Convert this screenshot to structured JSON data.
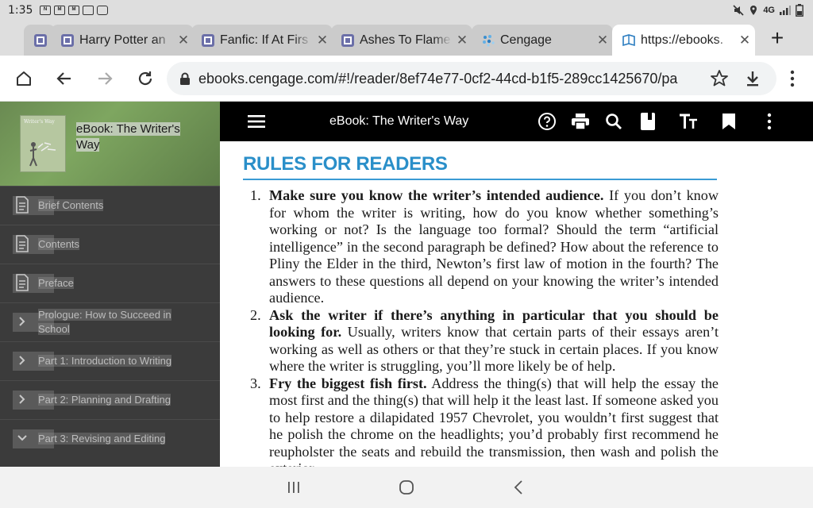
{
  "status": {
    "time": "1:35",
    "notifications": [
      "news-icon",
      "mail-icon",
      "mail-icon",
      "calendar-icon",
      "message-icon"
    ],
    "right_text": "4G"
  },
  "tabs": [
    {
      "title": "",
      "favicon": "reader-icon"
    },
    {
      "title": "Harry Potter an",
      "favicon": "reader-icon"
    },
    {
      "title": "Fanfic: If At Firs",
      "favicon": "reader-icon"
    },
    {
      "title": "Ashes To Flame",
      "favicon": "reader-icon"
    },
    {
      "title": "Cengage",
      "favicon": "cengage-icon"
    },
    {
      "title": "https://ebooks.",
      "favicon": "book-icon"
    }
  ],
  "newtab_label": "+",
  "toolbar": {
    "url": "ebooks.cengage.com/#!/reader/8ef74e77-0cf2-44cd-b1f5-289cc1425670/pa"
  },
  "sidebar": {
    "book_title": "eBook: The Writer's Way",
    "cover_title": "Writer's Way",
    "items": [
      {
        "label": "Brief Contents",
        "icon": "document-icon"
      },
      {
        "label": "Contents",
        "icon": "document-icon"
      },
      {
        "label": "Preface",
        "icon": "document-icon"
      },
      {
        "label": "Prologue: How to Succeed in School",
        "icon": "chevron-right-icon"
      },
      {
        "label": "Part 1: Introduction to Writing",
        "icon": "chevron-right-icon"
      },
      {
        "label": "Part 2: Planning and Drafting",
        "icon": "chevron-right-icon"
      },
      {
        "label": "Part 3: Revising and Editing",
        "icon": "chevron-down-icon"
      }
    ]
  },
  "reader": {
    "title": "eBook: The Writer's Way",
    "heading": "RULES FOR READERS",
    "rules": [
      {
        "num": "1.",
        "lead": "Make sure you know the writer’s intended audience.",
        "text": " If you don’t know for whom the writer is writing, how do you know whether something’s working or not? Is the language too formal? Should the term “artificial intelligence” in the second paragraph be defined? How about the refer­ence to Pliny the Elder in the third, Newton’s first law of motion in the fourth? The answers to these questions all depend on your knowing the writer’s intended audience."
      },
      {
        "num": "2.",
        "lead": "Ask the writer if there’s anything in particular that you should be looking for.",
        "text": " Usually, writers know that certain parts of their essays aren’t working as well as others or that they’re stuck in certain places. If you know where the writer is struggling, you’ll more likely be of help."
      },
      {
        "num": "3.",
        "lead": "Fry the biggest fish first.",
        "text": " Address the thing(s) that will help the essay the most first and the thing(s) that will help it the least last. If someone asked you to help restore a dilapidated 1957 Chevrolet, you wouldn’t first sug­gest that he polish the chrome on the headlights; you’d probably first rec­ommend he reupholster the seats and rebuild the transmission, then wash and polish the exterior."
      }
    ]
  },
  "colors": {
    "heading": "#2a8fc9",
    "sidebar_bg": "#3b3b3b",
    "reader_bar": "#000000"
  }
}
